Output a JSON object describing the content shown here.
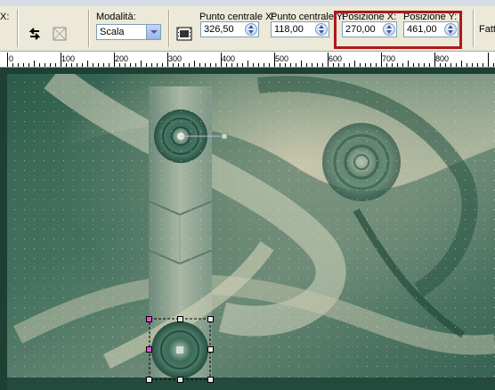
{
  "toolbar": {
    "cut_label": "X:",
    "modalita_label": "Modalità:",
    "modalita_value": "Scala",
    "punto_x_label": "Punto centrale X:",
    "punto_x_value": "326,50",
    "punto_y_label": "Punto centrale Y:",
    "punto_y_value": "118,00",
    "pos_x_label": "Posizione X:",
    "pos_x_value": "270,00",
    "pos_y_label": "Posizione Y:",
    "pos_y_value": "461,00",
    "fatt_label": "Fatt"
  },
  "ruler": {
    "ticks": [
      "0",
      "100",
      "200",
      "300",
      "400",
      "500",
      "600",
      "700",
      "800"
    ]
  },
  "colors": {
    "highlight": "#b0161d",
    "canvas_green": "#2f6150",
    "canvas_light": "#c9c7ac"
  }
}
